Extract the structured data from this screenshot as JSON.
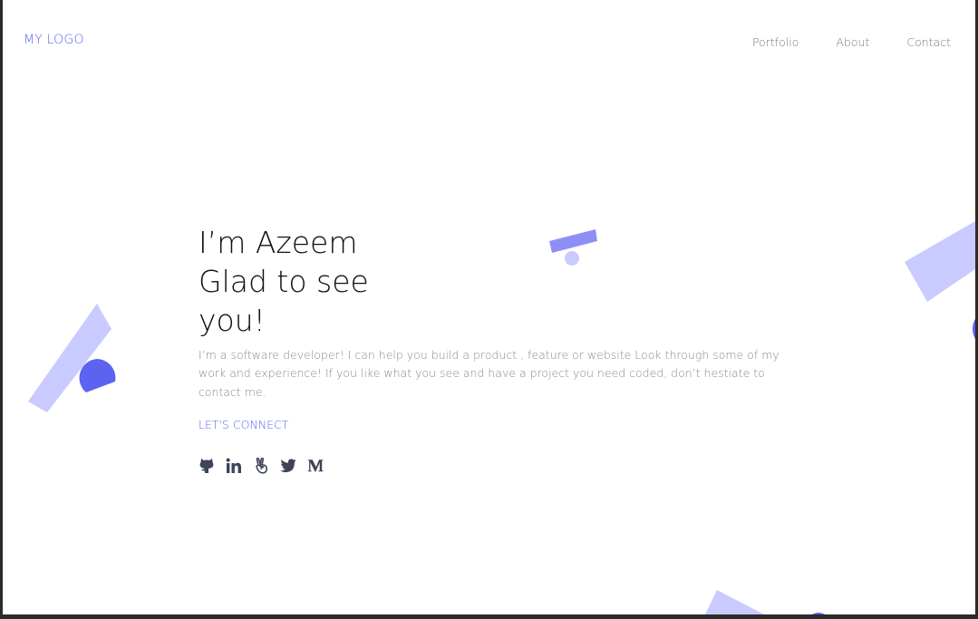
{
  "header": {
    "logo": "MY LOGO",
    "nav": [
      {
        "label": "Portfolio"
      },
      {
        "label": "About"
      },
      {
        "label": "Contact"
      }
    ]
  },
  "hero": {
    "title_lines": [
      "I’m Azeem",
      "Glad to see",
      "you!"
    ],
    "description": "I’m a software developer! I can help you build a product , feature or website Look through some of my work and experience! If you like what you see and have a project you need coded, don’t hestiate to contact me.",
    "cta": "LET'S CONNECT"
  },
  "socials": [
    {
      "name": "github-icon"
    },
    {
      "name": "linkedin-icon"
    },
    {
      "name": "angellist-icon"
    },
    {
      "name": "twitter-icon"
    },
    {
      "name": "medium-icon"
    }
  ],
  "colors": {
    "accent": "#5b63f0",
    "shape_light": "#c9caff",
    "shape_mid": "#8e8ff6",
    "icon": "#3d4458"
  }
}
